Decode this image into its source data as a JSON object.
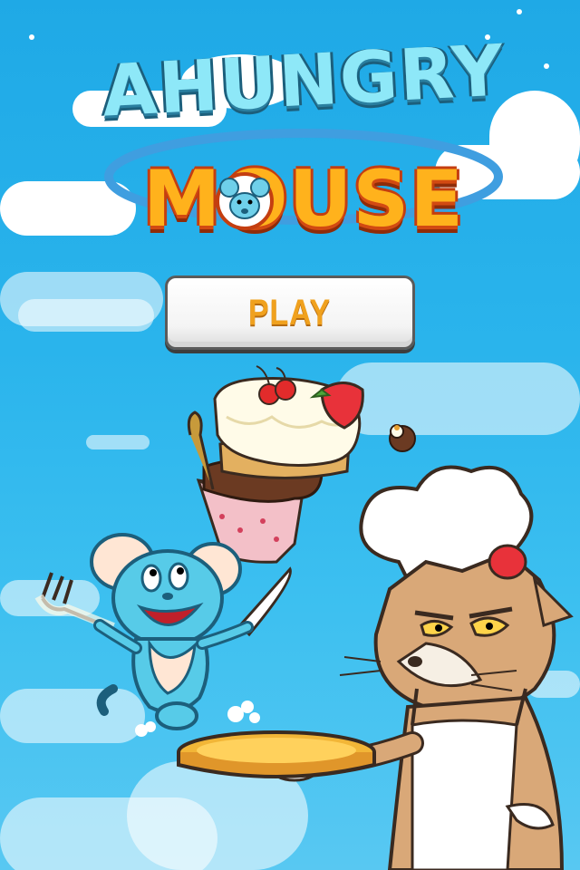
{
  "title": {
    "line1": "AHUNGRY",
    "line2": "MOUSE"
  },
  "menu": {
    "play_label": "PLAY"
  },
  "colors": {
    "sky_top": "#1fa9e6",
    "sky_bottom": "#58c8f2",
    "title_blue": "#8ee8f8",
    "title_orange": "#ffb21c",
    "play_text": "#f0a11e"
  },
  "icons": [
    "mouse-character",
    "cat-chef-character",
    "cake-icon",
    "plate-icon",
    "cookie-icon"
  ]
}
